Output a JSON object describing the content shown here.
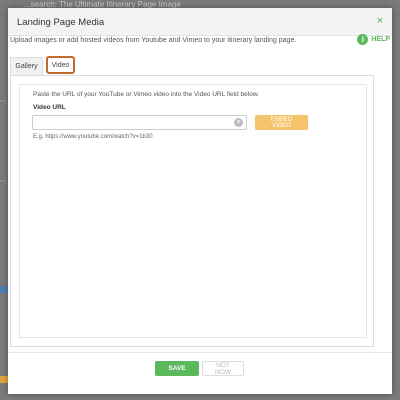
{
  "background": {
    "title_fragment": "...search: The Ultimate Itinerary Page Image"
  },
  "modal": {
    "title": "Landing Page Media",
    "close_glyph": "×",
    "intro": "Upload images or add hosted videos from Youtube and Vimeo to your itinerary landing page.",
    "help_label": "HELP",
    "help_glyph": "i",
    "tabs": [
      {
        "label": "Gallery",
        "active": false
      },
      {
        "label": "Video",
        "active": true
      }
    ],
    "video": {
      "instructions": "Paste the URL of your YouTube or Vimeo video into the Video URL field below.",
      "field_label": "Video URL",
      "input_value": "",
      "clear_glyph": "×",
      "embed_label": "EMBED VIDEO",
      "example": "E.g. https://www.youtube.com/watch?v=1b30"
    },
    "footer": {
      "save_label": "SAVE",
      "not_now_label": "NOT NOW"
    }
  },
  "colors": {
    "accent_green": "#5cb85c",
    "embed_orange": "#f5c46a",
    "tab_highlight": "#c06a2e"
  }
}
